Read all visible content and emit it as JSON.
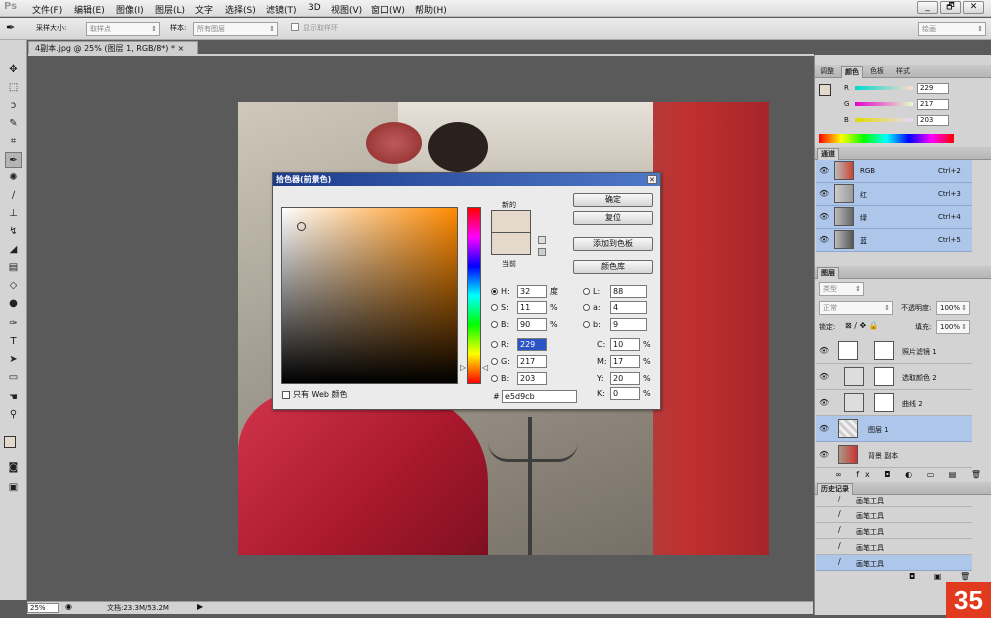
{
  "app": {
    "logo": "Ps"
  },
  "menus": [
    "文件(F)",
    "编辑(E)",
    "图像(I)",
    "图层(L)",
    "文字",
    "选择(S)",
    "滤镜(T)",
    "3D",
    "视图(V)",
    "窗口(W)",
    "帮助(H)"
  ],
  "window_buttons": [
    "_",
    "🗗",
    "✕"
  ],
  "options": {
    "sample_size_label": "采样大小:",
    "sample_size_value": "取样点",
    "sample_label": "样本:",
    "sample_value": "所有图层",
    "show_ring_label": "显示取样环",
    "workspace": "绘画"
  },
  "document_tab": "4副本.jpg @ 25% (图层 1, RGB/8*) *",
  "status": {
    "zoom": "25%",
    "doc": "文档:23.3M/53.2M"
  },
  "badge": "35",
  "color_panel": {
    "tabs": [
      "调整",
      "颜色",
      "色板",
      "样式"
    ],
    "active_tab": "颜色",
    "channels": [
      {
        "name": "R",
        "value": "229"
      },
      {
        "name": "G",
        "value": "217"
      },
      {
        "name": "B",
        "value": "203"
      }
    ],
    "swatch": "#e5d9cb"
  },
  "channels_panel": {
    "title": "通道",
    "items": [
      {
        "name": "RGB",
        "shortcut": "Ctrl+2"
      },
      {
        "name": "红",
        "shortcut": "Ctrl+3"
      },
      {
        "name": "绿",
        "shortcut": "Ctrl+4"
      },
      {
        "name": "蓝",
        "shortcut": "Ctrl+5"
      }
    ]
  },
  "layers_panel": {
    "title": "图层",
    "kind": "类型",
    "blend": "正常",
    "opacity_label": "不透明度:",
    "opacity": "100%",
    "lock_label": "锁定:",
    "fill_label": "填充:",
    "fill": "100%",
    "layers": [
      {
        "name": "照片滤镜 1",
        "selected": false
      },
      {
        "name": "选取颜色 2",
        "selected": false
      },
      {
        "name": "曲线 2",
        "selected": false
      },
      {
        "name": "图层 1",
        "selected": true
      },
      {
        "name": "背景 副本",
        "selected": false
      }
    ]
  },
  "history_panel": {
    "title": "历史记录",
    "items": [
      "画笔工具",
      "画笔工具",
      "画笔工具",
      "画笔工具",
      "画笔工具"
    ]
  },
  "color_picker": {
    "title": "拾色器(前景色)",
    "close": "✕",
    "buttons": [
      "确定",
      "复位",
      "添加到色板",
      "颜色库"
    ],
    "new_label": "新的",
    "current_label": "当前",
    "new_color": "#e5d9cb",
    "current_color": "#e5d9cb",
    "web_only_label": "只有 Web 颜色",
    "hsb": [
      {
        "label": "H:",
        "value": "32",
        "unit": "度",
        "selected": true
      },
      {
        "label": "S:",
        "value": "11",
        "unit": "%",
        "selected": false
      },
      {
        "label": "B:",
        "value": "90",
        "unit": "%",
        "selected": false
      }
    ],
    "rgb": [
      {
        "label": "R:",
        "value": "229"
      },
      {
        "label": "G:",
        "value": "217"
      },
      {
        "label": "B:",
        "value": "203"
      }
    ],
    "lab": [
      {
        "label": "L:",
        "value": "88"
      },
      {
        "label": "a:",
        "value": "4"
      },
      {
        "label": "b:",
        "value": "9"
      }
    ],
    "cmyk": [
      {
        "label": "C:",
        "value": "10",
        "unit": "%"
      },
      {
        "label": "M:",
        "value": "17",
        "unit": "%"
      },
      {
        "label": "Y:",
        "value": "20",
        "unit": "%"
      },
      {
        "label": "K:",
        "value": "0",
        "unit": "%"
      }
    ],
    "hex_label": "#",
    "hex": "e5d9cb"
  }
}
